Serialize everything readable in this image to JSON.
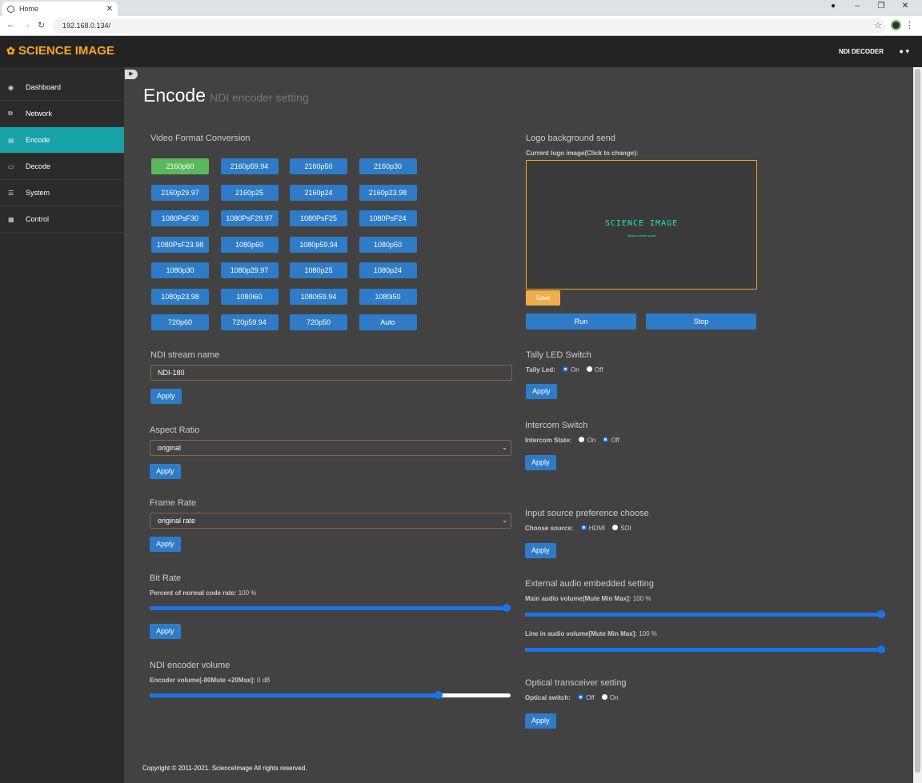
{
  "browser": {
    "tab_title": "Home",
    "url": "192.168.0.134/"
  },
  "header": {
    "brand": "SCIENCE IMAGE",
    "device": "NDI DECODER"
  },
  "sidebar": {
    "items": [
      {
        "label": "Dashboard",
        "icon": "dashboard-icon",
        "active": false
      },
      {
        "label": "Network",
        "icon": "network-icon",
        "active": false
      },
      {
        "label": "Encode",
        "icon": "chart-icon",
        "active": true
      },
      {
        "label": "Decode",
        "icon": "monitor-icon",
        "active": false
      },
      {
        "label": "System",
        "icon": "server-icon",
        "active": false
      },
      {
        "label": "Control",
        "icon": "grid-icon",
        "active": false
      }
    ]
  },
  "page": {
    "title": "Encode",
    "subtitle": "NDI encoder setting"
  },
  "video_format": {
    "title": "Video Format Conversion",
    "selected": "2160p60",
    "formats": [
      "2160p60",
      "2160p59.94",
      "2160p50",
      "2160p30",
      "2160p29.97",
      "2160p25",
      "2160p24",
      "2160p23.98",
      "1080PsF30",
      "1080PsF29.97",
      "1080PsF25",
      "1080PsF24",
      "1080PsF23.98",
      "1080p60",
      "1080p59.94",
      "1080p50",
      "1080p30",
      "1080p29.97",
      "1080p25",
      "1080p24",
      "1080p23.98",
      "1080i60",
      "1080i59.94",
      "1080i50",
      "720p60",
      "720p59.94",
      "720p50",
      "Auto"
    ]
  },
  "ndi_stream": {
    "title": "NDI stream name",
    "value": "NDI-180",
    "apply": "Apply"
  },
  "aspect_ratio": {
    "title": "Aspect Ratio",
    "value": "original",
    "apply": "Apply"
  },
  "frame_rate": {
    "title": "Frame Rate",
    "value": "original rate",
    "apply": "Apply"
  },
  "bit_rate": {
    "title": "Bit Rate",
    "label": "Percent of normal code rate:",
    "value_text": "100 %",
    "percent": 100,
    "apply": "Apply"
  },
  "ndi_volume": {
    "title": "NDI encoder volume",
    "label": "Encoder volume[-80Mute +20Max]:",
    "value_text": "0 dB",
    "value": 0,
    "min": -80,
    "max": 20
  },
  "logo": {
    "title": "Logo background send",
    "label": "Current logo image(Click to change):",
    "image_text": "SCIENCE IMAGE",
    "image_subtext": "Make a better world",
    "save": "Save",
    "run": "Run",
    "stop": "Stop"
  },
  "tally": {
    "title": "Tally LED Switch",
    "label": "Tally Led:",
    "on": "On",
    "off": "Off",
    "selected": "On",
    "apply": "Apply"
  },
  "intercom": {
    "title": "Intercom Switch",
    "label": "Intercom State:",
    "on": "On",
    "off": "Off",
    "selected": "Off",
    "apply": "Apply"
  },
  "input_source": {
    "title": "Input source preference choose",
    "label": "Choose source:",
    "hdmi": "HDMI",
    "sdi": "SDI",
    "selected": "HDMI",
    "apply": "Apply"
  },
  "ext_audio": {
    "title": "External audio embedded setting",
    "main_label": "Main audio volume[Mute Min Max]:",
    "main_value_text": "100 %",
    "main_percent": 100,
    "line_label": "Line in audio volume[Mute Min Max]:",
    "line_value_text": "100 %",
    "line_percent": 100
  },
  "optical": {
    "title": "Optical transceiver setting",
    "label": "Optical switch:",
    "off": "Off",
    "on": "On",
    "selected": "Off",
    "apply": "Apply"
  },
  "footer": {
    "text": "Copyright © 2011-2021. ScienceImage All rights reserved."
  },
  "colors": {
    "accent": "#17a2a8",
    "brand": "#f5a623",
    "button": "#2e7cc8",
    "selected": "#5cb85c"
  }
}
